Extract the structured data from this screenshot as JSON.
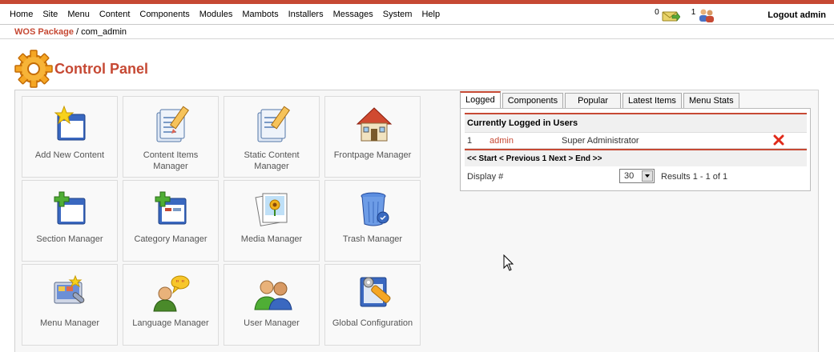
{
  "menu": [
    "Home",
    "Site",
    "Menu",
    "Content",
    "Components",
    "Modules",
    "Mambots",
    "Installers",
    "Messages",
    "System",
    "Help"
  ],
  "status": {
    "messages_count": "0",
    "users_count": "1",
    "logout_label": "Logout admin"
  },
  "breadcrumb": {
    "package": "WOS Package",
    "separator": " / ",
    "component": "com_admin"
  },
  "page_title": "Control Panel",
  "tiles": [
    {
      "label": "Add New Content",
      "icon": "add-content-icon"
    },
    {
      "label": "Content Items Manager",
      "icon": "content-items-icon"
    },
    {
      "label": "Static Content Manager",
      "icon": "static-content-icon"
    },
    {
      "label": "Frontpage Manager",
      "icon": "frontpage-icon"
    },
    {
      "label": "Section Manager",
      "icon": "section-icon"
    },
    {
      "label": "Category Manager",
      "icon": "category-icon"
    },
    {
      "label": "Media Manager",
      "icon": "media-icon"
    },
    {
      "label": "Trash Manager",
      "icon": "trash-icon"
    },
    {
      "label": "Menu Manager",
      "icon": "menu-icon"
    },
    {
      "label": "Language Manager",
      "icon": "language-icon"
    },
    {
      "label": "User Manager",
      "icon": "users-icon"
    },
    {
      "label": "Global Configuration",
      "icon": "config-icon"
    }
  ],
  "tabs": [
    "Logged",
    "Components",
    "Popular",
    "Latest Items",
    "Menu Stats"
  ],
  "logged": {
    "header": "Currently Logged in Users",
    "row": {
      "num": "1",
      "user": "admin",
      "group": "Super Administrator"
    },
    "pager": "<< Start < Previous 1 Next > End >>",
    "display_label": "Display #",
    "display_value": "30",
    "results": "Results 1 - 1 of 1"
  },
  "colors": {
    "accent": "#c64934",
    "link": "#c64934"
  }
}
